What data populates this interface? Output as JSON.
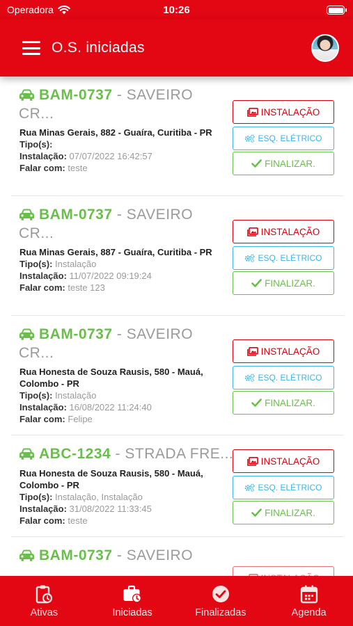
{
  "status": {
    "carrier": "Operadora",
    "time": "10:26"
  },
  "header": {
    "title": "O.S. iniciadas"
  },
  "colors": {
    "primary": "#e30613",
    "green": "#6abf4b",
    "blue": "#3fb3e4",
    "gray": "#9a9a9a"
  },
  "labels": {
    "tipo": "Tipo(s):",
    "instalacao": "Instalação:",
    "falar": "Falar com:"
  },
  "buttons": {
    "instalacao": "INSTALAÇÃO",
    "eletrico": "ESQ. ELÉTRICO",
    "finalizar": "FINALIZAR."
  },
  "orders": [
    {
      "plate": "BAM-0737",
      "sep": " - ",
      "model": "SAVEIRO CR...",
      "address": "Rua Minas Gerais, 882 - Guaíra, Curitiba - PR",
      "tipos": "",
      "instalacao": "07/07/2022 16:42:57",
      "falar": "teste"
    },
    {
      "plate": "BAM-0737",
      "sep": " - ",
      "model": "SAVEIRO CR...",
      "address": "Rua Minas Gerais, 887 - Guaíra, Curitiba - PR",
      "tipos": "Instalação",
      "instalacao": "11/07/2022 09:19:24",
      "falar": "teste 123"
    },
    {
      "plate": "BAM-0737",
      "sep": " - ",
      "model": "SAVEIRO CR...",
      "address": "Rua Honesta de Souza Rausis, 580 - Mauá, Colombo - PR",
      "tipos": "Instalação",
      "instalacao": "16/08/2022 11:24:40",
      "falar": "Felipe"
    },
    {
      "plate": "ABC-1234",
      "sep": " - ",
      "model": "STRADA FRE...",
      "address": "Rua Honesta de Souza Rausis, 580 - Mauá, Colombo - PR",
      "tipos": "Instalação, Instalação",
      "instalacao": "31/08/2022 11:33:45",
      "falar": "teste"
    },
    {
      "plate": "BAM-0737",
      "sep": " - ",
      "model": "SAVEIRO"
    }
  ],
  "tabs": [
    {
      "label": "Ativas",
      "icon": "clipboard-clock-icon"
    },
    {
      "label": "Iniciadas",
      "icon": "briefcase-clock-icon",
      "active": true
    },
    {
      "label": "Finalizadas",
      "icon": "check-circle-icon"
    },
    {
      "label": "Agenda",
      "icon": "calendar-icon"
    }
  ]
}
